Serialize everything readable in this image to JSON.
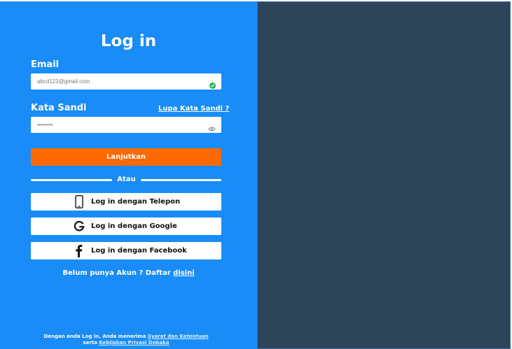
{
  "login": {
    "title": "Log in",
    "email_label": "Email",
    "email_value": "abcd123@gmail.com",
    "password_label": "Kata Sandi",
    "password_value": "••••••••",
    "forgot_password": "Lupa Kata Sandi ?",
    "submit": "Lanjutkan",
    "divider": "Atau",
    "phone_login": "Log in dengan Telepon",
    "google_login": "Log in dengan Google",
    "facebook_login": "Log in dengan Facebook",
    "signup_prompt": "Belum punya Akun ? Daftar",
    "signup_link": "disini",
    "terms_prefix": "Dengan anda Log in, Anda menerima",
    "terms_link": "Syarat dan Ketentuan",
    "terms_mid": "serta",
    "privacy_link": "Kebijakan Privasi Dobaka"
  },
  "icons": {
    "email_status": "check-circle-icon",
    "password_toggle": "eye-icon",
    "phone": "phone-icon",
    "google": "google-icon",
    "facebook": "facebook-icon"
  },
  "colors": {
    "panel_blue": "#1a8cf7",
    "dark_panel": "#2d4459",
    "primary_orange": "#ff6a00",
    "success_green": "#27b34a"
  }
}
